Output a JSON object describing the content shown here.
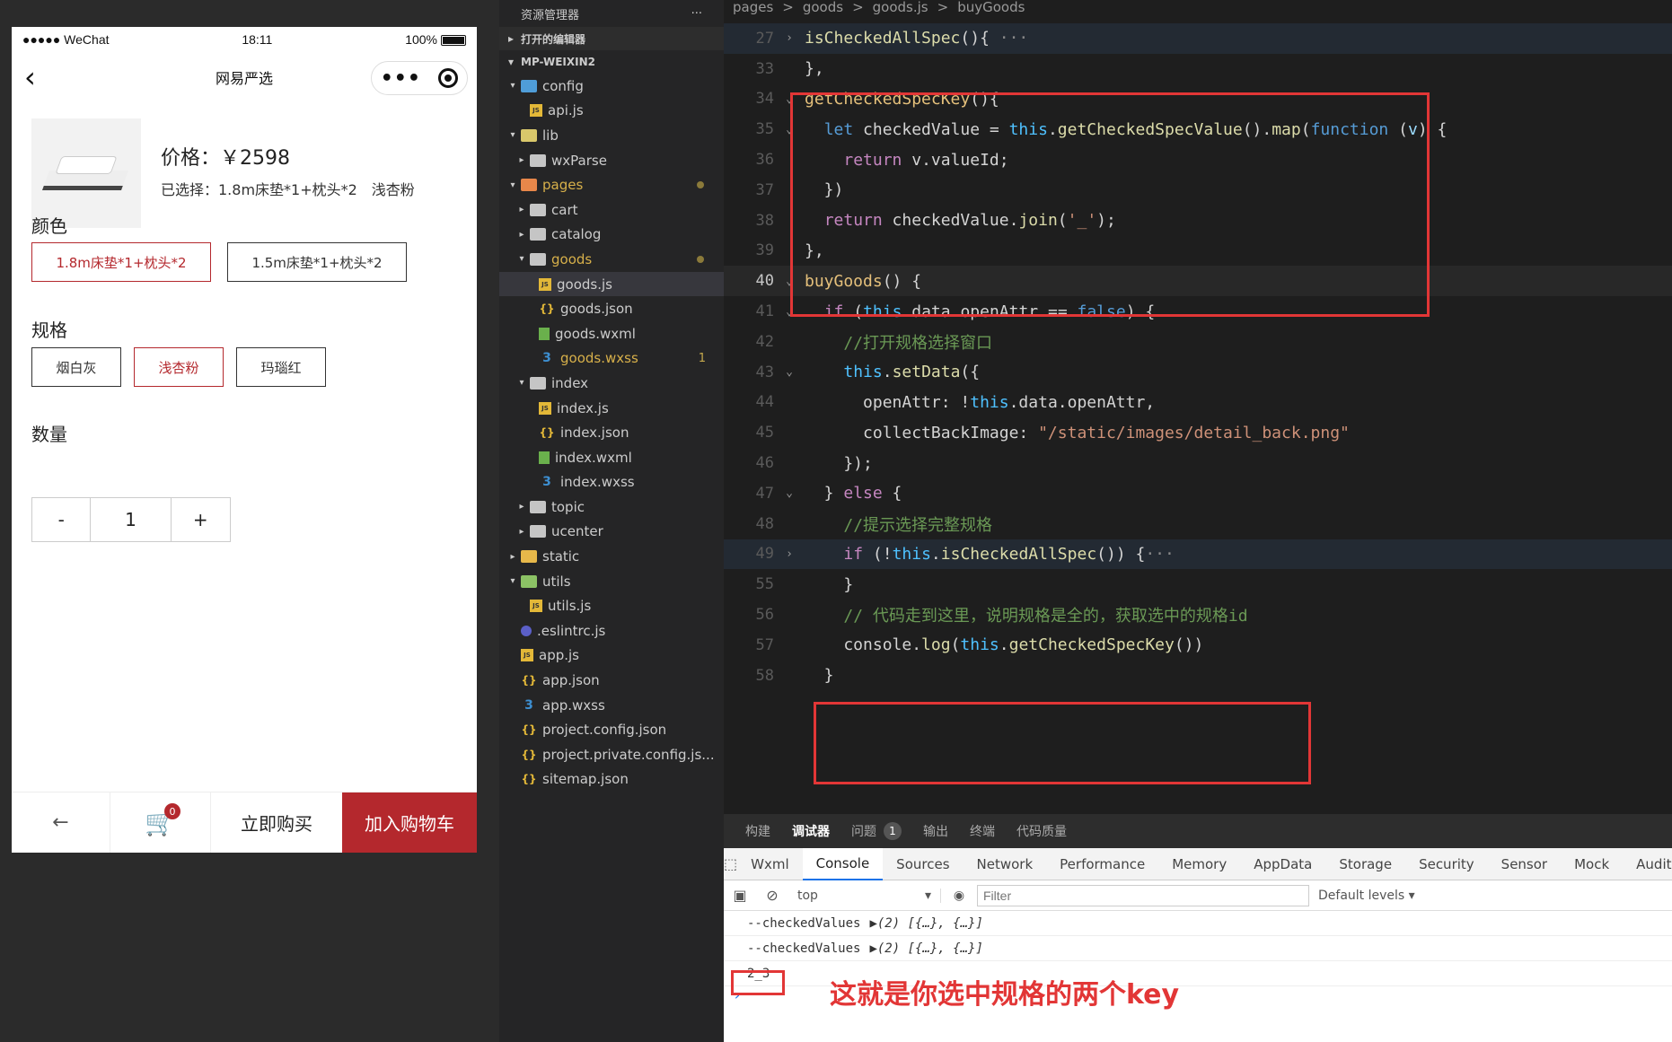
{
  "phone": {
    "status": {
      "carrier": "●●●●● WeChat",
      "time": "18:11",
      "battery": "100%"
    },
    "nav": {
      "title": "网易严选",
      "back_icon": "‹",
      "more_icon": "•••"
    },
    "product": {
      "price": "价格：￥2598",
      "selected": "已选择：1.8m床垫*1+枕头*2　浅杏粉"
    },
    "color": {
      "label": "颜色",
      "options": [
        "1.8m床垫*1+枕头*2",
        "1.5m床垫*1+枕头*2"
      ],
      "selected_index": 0
    },
    "spec": {
      "label": "规格",
      "options": [
        "烟白灰",
        "浅杏粉",
        "玛瑙红"
      ],
      "selected_index": 1
    },
    "quantity": {
      "label": "数量",
      "minus": "-",
      "value": "1",
      "plus": "+"
    },
    "bottom": {
      "back": "←",
      "cart_badge": "0",
      "buy_now": "立即购买",
      "add_to_cart": "加入购物车"
    }
  },
  "explorer": {
    "title": "资源管理器",
    "more": "···",
    "open_editors": "打开的编辑器",
    "project": "MP-WEIXIN2",
    "tree": [
      {
        "name": "config",
        "indent": 1,
        "arrow": "▾",
        "icon": "folder-cfg"
      },
      {
        "name": "api.js",
        "indent": 2,
        "arrow": "",
        "icon": "js"
      },
      {
        "name": "lib",
        "indent": 1,
        "arrow": "▾",
        "icon": "folder-lib"
      },
      {
        "name": "wxParse",
        "indent": 2,
        "arrow": "▸",
        "icon": "folder"
      },
      {
        "name": "pages",
        "indent": 1,
        "arrow": "▾",
        "icon": "folder-pages",
        "modified": "dot"
      },
      {
        "name": "cart",
        "indent": 2,
        "arrow": "▸",
        "icon": "folder"
      },
      {
        "name": "catalog",
        "indent": 2,
        "arrow": "▸",
        "icon": "folder"
      },
      {
        "name": "goods",
        "indent": 2,
        "arrow": "▾",
        "icon": "folder",
        "modified": "dot"
      },
      {
        "name": "goods.js",
        "indent": 3,
        "arrow": "",
        "icon": "js",
        "active": true
      },
      {
        "name": "goods.json",
        "indent": 3,
        "arrow": "",
        "icon": "json"
      },
      {
        "name": "goods.wxml",
        "indent": 3,
        "arrow": "",
        "icon": "wxml"
      },
      {
        "name": "goods.wxss",
        "indent": 3,
        "arrow": "",
        "icon": "wxss",
        "modified": "1"
      },
      {
        "name": "index",
        "indent": 2,
        "arrow": "▾",
        "icon": "folder"
      },
      {
        "name": "index.js",
        "indent": 3,
        "arrow": "",
        "icon": "js"
      },
      {
        "name": "index.json",
        "indent": 3,
        "arrow": "",
        "icon": "json"
      },
      {
        "name": "index.wxml",
        "indent": 3,
        "arrow": "",
        "icon": "wxml"
      },
      {
        "name": "index.wxss",
        "indent": 3,
        "arrow": "",
        "icon": "wxss"
      },
      {
        "name": "topic",
        "indent": 2,
        "arrow": "▸",
        "icon": "folder"
      },
      {
        "name": "ucenter",
        "indent": 2,
        "arrow": "▸",
        "icon": "folder"
      },
      {
        "name": "static",
        "indent": 1,
        "arrow": "▸",
        "icon": "folder-static"
      },
      {
        "name": "utils",
        "indent": 1,
        "arrow": "▾",
        "icon": "folder-utils"
      },
      {
        "name": "utils.js",
        "indent": 2,
        "arrow": "",
        "icon": "js"
      },
      {
        "name": ".eslintrc.js",
        "indent": 1,
        "arrow": "",
        "icon": "eslint"
      },
      {
        "name": "app.js",
        "indent": 1,
        "arrow": "",
        "icon": "js"
      },
      {
        "name": "app.json",
        "indent": 1,
        "arrow": "",
        "icon": "json"
      },
      {
        "name": "app.wxss",
        "indent": 1,
        "arrow": "",
        "icon": "wxss"
      },
      {
        "name": "project.config.json",
        "indent": 1,
        "arrow": "",
        "icon": "json"
      },
      {
        "name": "project.private.config.js...",
        "indent": 1,
        "arrow": "",
        "icon": "json"
      },
      {
        "name": "sitemap.json",
        "indent": 1,
        "arrow": "",
        "icon": "json"
      }
    ]
  },
  "editor": {
    "breadcrumb": [
      "pages",
      ">",
      "goods",
      ">",
      "goods.js",
      ">",
      "buyGoods"
    ],
    "current_line": "40",
    "lines": [
      {
        "n": "27",
        "fold": "›",
        "bg": "folded",
        "tokens": [
          [
            "fn",
            "isCheckedAllSpec"
          ],
          [
            "punc",
            "(){"
          ],
          [
            "ellipsis",
            " ···"
          ]
        ]
      },
      {
        "n": "33",
        "fold": "",
        "tokens": [
          [
            "punc",
            "},"
          ]
        ]
      },
      {
        "n": "34",
        "fold": "⌄",
        "tokens": [
          [
            "fnc",
            "getCheckedSpecKey"
          ],
          [
            "punc",
            "(){"
          ]
        ]
      },
      {
        "n": "35",
        "fold": "⌄",
        "tokens": [
          [
            "punc",
            "  "
          ],
          [
            "kb",
            "let"
          ],
          [
            "punc",
            " checkedValue = "
          ],
          [
            "this",
            "this"
          ],
          [
            "punc",
            "."
          ],
          [
            "fn",
            "getCheckedSpecValue"
          ],
          [
            "punc",
            "()."
          ],
          [
            "fn",
            "map"
          ],
          [
            "punc",
            "("
          ],
          [
            "kb",
            "function"
          ],
          [
            "punc",
            " ("
          ],
          [
            "prop",
            "v"
          ],
          [
            "punc",
            ") {"
          ]
        ]
      },
      {
        "n": "36",
        "fold": "",
        "tokens": [
          [
            "punc",
            "    "
          ],
          [
            "kw",
            "return"
          ],
          [
            "punc",
            " v.valueId;"
          ]
        ]
      },
      {
        "n": "37",
        "fold": "",
        "tokens": [
          [
            "punc",
            "  })"
          ]
        ]
      },
      {
        "n": "38",
        "fold": "",
        "tokens": [
          [
            "punc",
            "  "
          ],
          [
            "kw",
            "return"
          ],
          [
            "punc",
            " checkedValue."
          ],
          [
            "fn",
            "join"
          ],
          [
            "punc",
            "("
          ],
          [
            "str",
            "'_'"
          ],
          [
            "punc",
            ");"
          ]
        ]
      },
      {
        "n": "39",
        "fold": "",
        "tokens": [
          [
            "punc",
            "},"
          ]
        ]
      },
      {
        "n": "40",
        "fold": "⌄",
        "bg": "hl",
        "tokens": [
          [
            "fnc",
            "buyGoods"
          ],
          [
            "punc",
            "() {"
          ]
        ]
      },
      {
        "n": "41",
        "fold": "⌄",
        "tokens": [
          [
            "punc",
            "  "
          ],
          [
            "kw",
            "if"
          ],
          [
            "punc",
            " ("
          ],
          [
            "this",
            "this"
          ],
          [
            "punc",
            ".data.openAttr == "
          ],
          [
            "kb",
            "false"
          ],
          [
            "punc",
            ") {"
          ]
        ]
      },
      {
        "n": "42",
        "fold": "",
        "tokens": [
          [
            "punc",
            "    "
          ],
          [
            "cmt",
            "//打开规格选择窗口"
          ]
        ]
      },
      {
        "n": "43",
        "fold": "⌄",
        "tokens": [
          [
            "punc",
            "    "
          ],
          [
            "this",
            "this"
          ],
          [
            "punc",
            "."
          ],
          [
            "fn",
            "setData"
          ],
          [
            "punc",
            "({"
          ]
        ]
      },
      {
        "n": "44",
        "fold": "",
        "tokens": [
          [
            "punc",
            "      openAttr: !"
          ],
          [
            "this",
            "this"
          ],
          [
            "punc",
            ".data.openAttr,"
          ]
        ]
      },
      {
        "n": "45",
        "fold": "",
        "tokens": [
          [
            "punc",
            "      collectBackImage: "
          ],
          [
            "str",
            "\"/static/images/detail_back.png\""
          ]
        ]
      },
      {
        "n": "46",
        "fold": "",
        "tokens": [
          [
            "punc",
            "    });"
          ]
        ]
      },
      {
        "n": "47",
        "fold": "⌄",
        "tokens": [
          [
            "punc",
            "  } "
          ],
          [
            "kw",
            "else"
          ],
          [
            "punc",
            " {"
          ]
        ]
      },
      {
        "n": "48",
        "fold": "",
        "tokens": [
          [
            "punc",
            "    "
          ],
          [
            "cmt",
            "//提示选择完整规格"
          ]
        ]
      },
      {
        "n": "49",
        "fold": "›",
        "bg": "folded",
        "tokens": [
          [
            "punc",
            "    "
          ],
          [
            "kw",
            "if"
          ],
          [
            "punc",
            " (!"
          ],
          [
            "this",
            "this"
          ],
          [
            "punc",
            "."
          ],
          [
            "fn",
            "isCheckedAllSpec"
          ],
          [
            "punc",
            "()) {"
          ],
          [
            "ellipsis",
            "···"
          ]
        ]
      },
      {
        "n": "55",
        "fold": "",
        "tokens": [
          [
            "punc",
            "    }"
          ]
        ]
      },
      {
        "n": "56",
        "fold": "",
        "tokens": [
          [
            "punc",
            "    "
          ],
          [
            "cmt",
            "// 代码走到这里，说明规格是全的，获取选中的规格id"
          ]
        ]
      },
      {
        "n": "57",
        "fold": "",
        "tokens": [
          [
            "punc",
            "    console."
          ],
          [
            "fn",
            "log"
          ],
          [
            "punc",
            "("
          ],
          [
            "this",
            "this"
          ],
          [
            "punc",
            "."
          ],
          [
            "fn",
            "getCheckedSpecKey"
          ],
          [
            "punc",
            "())"
          ]
        ]
      },
      {
        "n": "58",
        "fold": "",
        "tokens": [
          [
            "punc",
            "  }"
          ]
        ]
      }
    ]
  },
  "panel": {
    "tabs": [
      "构建",
      "调试器",
      "问题",
      "输出",
      "终端",
      "代码质量"
    ],
    "selected_tab": 1,
    "problems_count": "1",
    "devtools_tabs": [
      "Wxml",
      "Console",
      "Sources",
      "Network",
      "Performance",
      "Memory",
      "AppData",
      "Storage",
      "Security",
      "Sensor",
      "Mock",
      "Audits"
    ],
    "devtools_selected": 1,
    "context": "top",
    "filter_placeholder": "Filter",
    "levels": "Default levels ▾",
    "console": [
      {
        "text": "--checkedValues",
        "obj": "▶(2) [{…}, {…}]"
      },
      {
        "text": "--checkedValues",
        "obj": "▶(2) [{…}, {…}]"
      },
      {
        "text": "2_3",
        "obj": ""
      }
    ],
    "prompt": "›",
    "annotation": "这就是你选中规格的两个key"
  }
}
